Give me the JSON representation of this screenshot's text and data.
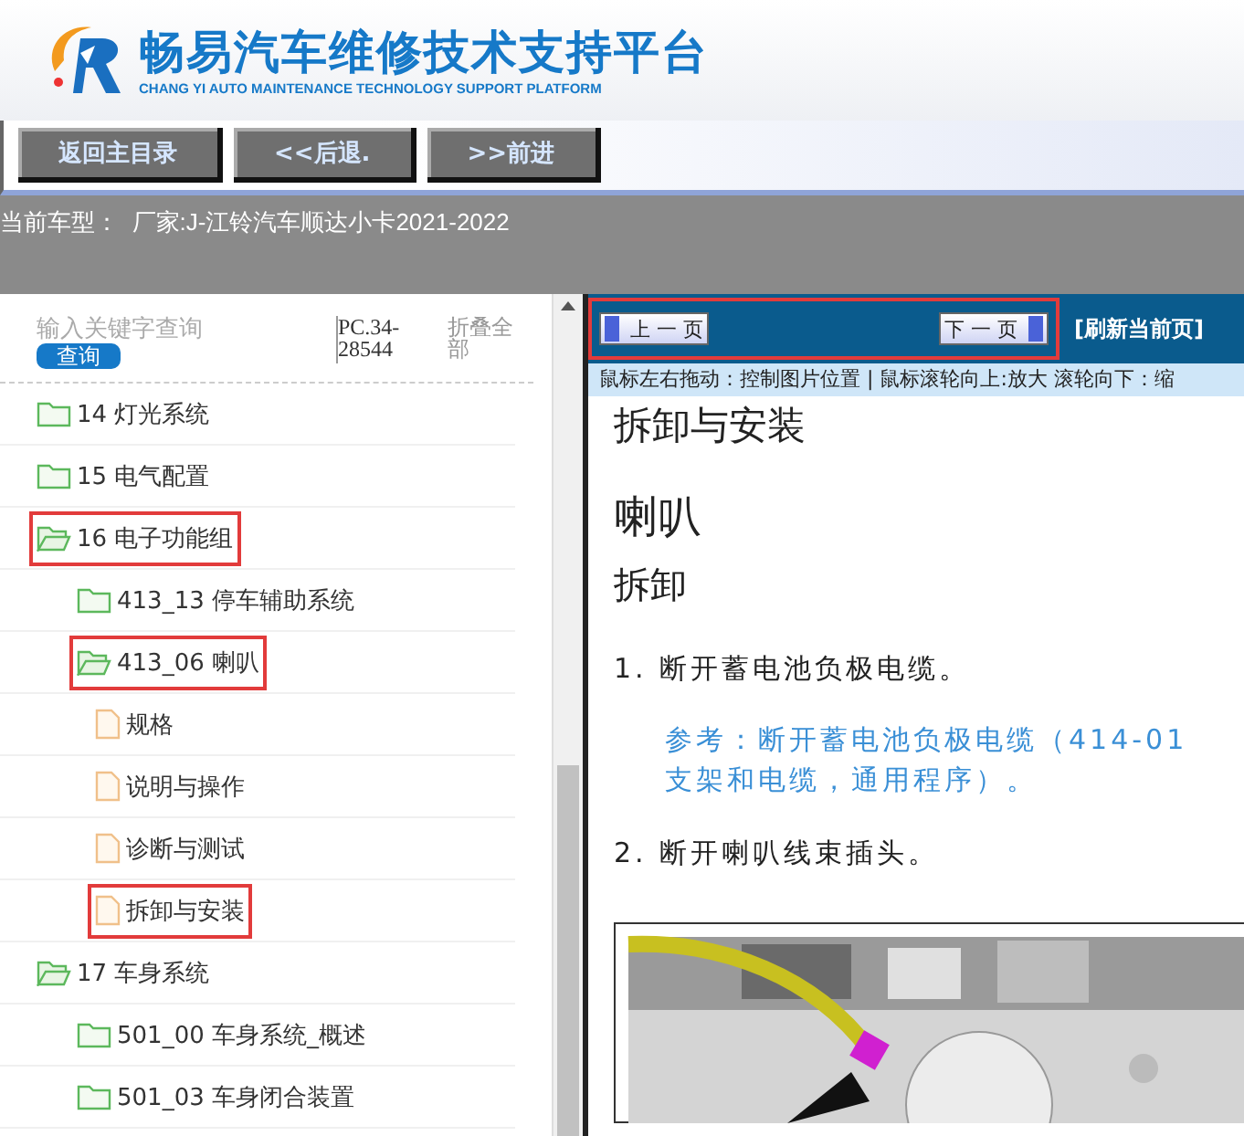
{
  "header": {
    "title": "畅易汽车维修技术支持平台",
    "subtitle": "CHANG YI AUTO MAINTENANCE TECHNOLOGY SUPPORT PLATFORM"
  },
  "toolbar": {
    "buttons": [
      "返回主目录",
      "<<后退.",
      ">>前进"
    ]
  },
  "vehicle": {
    "label": "当前车型：",
    "value": "厂家:J-江铃汽车顺达小卡2021-2022"
  },
  "sidebar": {
    "search": {
      "placeholder": "输入关键字查询",
      "button": "查询"
    },
    "code": "PC.34-28544",
    "collapse_all": "折叠全部",
    "tree": [
      {
        "label": "14 灯光系统",
        "kind": "folder",
        "expanded": false,
        "highlighted": false
      },
      {
        "label": "15 电气配置",
        "kind": "folder",
        "expanded": false,
        "highlighted": false
      },
      {
        "label": "16 电子功能组",
        "kind": "folder",
        "expanded": true,
        "highlighted": true,
        "children": [
          {
            "label": "413_13 停车辅助系统",
            "kind": "folder",
            "expanded": false,
            "highlighted": false
          },
          {
            "label": "413_06 喇叭",
            "kind": "folder",
            "expanded": true,
            "highlighted": true,
            "children": [
              {
                "label": "规格",
                "kind": "page",
                "highlighted": false
              },
              {
                "label": "说明与操作",
                "kind": "page",
                "highlighted": false
              },
              {
                "label": "诊断与测试",
                "kind": "page",
                "highlighted": false
              },
              {
                "label": "拆卸与安装",
                "kind": "page",
                "highlighted": true
              }
            ]
          }
        ]
      },
      {
        "label": "17 车身系统",
        "kind": "folder",
        "expanded": true,
        "highlighted": false,
        "children": [
          {
            "label": "501_00 车身系统_概述",
            "kind": "folder",
            "expanded": false,
            "highlighted": false
          },
          {
            "label": "501_03 车身闭合装置",
            "kind": "folder",
            "expanded": false,
            "highlighted": false
          }
        ]
      }
    ]
  },
  "viewer": {
    "pager": {
      "highlighted": true,
      "prev": "上 一 页",
      "next": "下 一 页"
    },
    "refresh": "[刷新当前页]",
    "hint": "鼠标左右拖动：控制图片位置 | 鼠标滚轮向上:放大   滚轮向下：缩",
    "document": {
      "title": "拆卸与安装",
      "heading": "喇叭",
      "section": "拆卸",
      "steps": [
        {
          "kind": "step",
          "number": "1.",
          "text": "断开蓄电池负极电缆。"
        },
        {
          "kind": "reference",
          "lines": [
            "参考：断开蓄电池负极电缆（414-01",
            "支架和电缆，通用程序）。"
          ]
        },
        {
          "kind": "step",
          "number": "2.",
          "text": "断开喇叭线束插头。"
        }
      ]
    }
  }
}
